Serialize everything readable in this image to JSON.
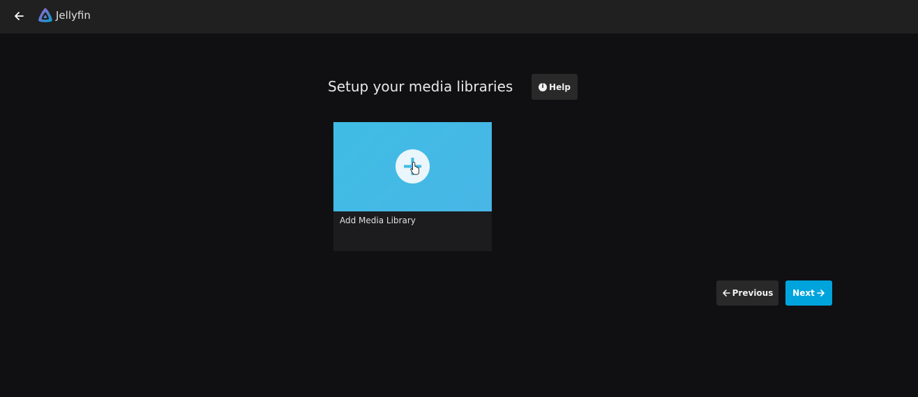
{
  "header": {
    "app_name": "Jellyfin",
    "back_icon": "arrow-left-icon",
    "logo_icon": "jellyfin-logo-icon"
  },
  "main": {
    "title": "Setup your media libraries",
    "help_button": {
      "label": "Help",
      "icon": "info-icon"
    },
    "library_card": {
      "label": "Add Media Library",
      "icon": "add-icon",
      "color": "#43BAE4"
    }
  },
  "footer_nav": {
    "previous_label": "Previous",
    "previous_icon": "arrow-left-icon",
    "next_label": "Next",
    "next_icon": "arrow-right-icon",
    "next_color": "#00A4DC"
  },
  "colors": {
    "background": "#101013",
    "header": "#202020",
    "button": "#292929"
  }
}
